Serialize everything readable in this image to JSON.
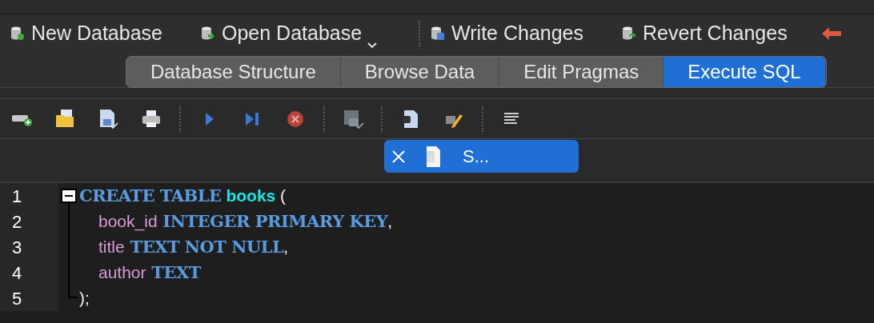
{
  "toolbar": {
    "buttons": [
      {
        "label": "New Database",
        "kind": "new",
        "dropdown": false
      },
      {
        "label": "Open Database",
        "kind": "open",
        "dropdown": true
      },
      {
        "label": "Write Changes",
        "kind": "write",
        "dropdown": false
      },
      {
        "label": "Revert Changes",
        "kind": "revert",
        "dropdown": false
      }
    ]
  },
  "tabs": [
    {
      "label": "Database Structure",
      "selected": false
    },
    {
      "label": "Browse Data",
      "selected": false
    },
    {
      "label": "Edit Pragmas",
      "selected": false
    },
    {
      "label": "Execute SQL",
      "selected": true
    }
  ],
  "sql_tab": {
    "label": "S...",
    "selected": true
  },
  "editor": {
    "lines": [
      {
        "number": "1",
        "indented": false,
        "kind": "foldstart",
        "tokens": [
          {
            "text": "CREATE TABLE",
            "kind": "keyword"
          },
          {
            "text": " books",
            "kind": "table"
          },
          {
            "text": " (",
            "kind": "punct"
          }
        ]
      },
      {
        "number": "2",
        "indented": true,
        "kind": "foldbody",
        "tokens": [
          {
            "text": "book_id",
            "kind": "column"
          },
          {
            "text": " INTEGER PRIMARY KEY",
            "kind": "keyword"
          },
          {
            "text": ",",
            "kind": "punct"
          }
        ]
      },
      {
        "number": "3",
        "indented": true,
        "kind": "foldbody",
        "tokens": [
          {
            "text": "title",
            "kind": "column"
          },
          {
            "text": " TEXT NOT NULL",
            "kind": "keyword"
          },
          {
            "text": ",",
            "kind": "punct"
          }
        ]
      },
      {
        "number": "4",
        "indented": true,
        "kind": "foldbody",
        "tokens": [
          {
            "text": "author",
            "kind": "column"
          },
          {
            "text": " TEXT",
            "kind": "keyword"
          }
        ]
      },
      {
        "number": "5",
        "indented": false,
        "kind": "foldend",
        "tokens": [
          {
            "text": ");",
            "kind": "punct"
          }
        ]
      }
    ]
  }
}
